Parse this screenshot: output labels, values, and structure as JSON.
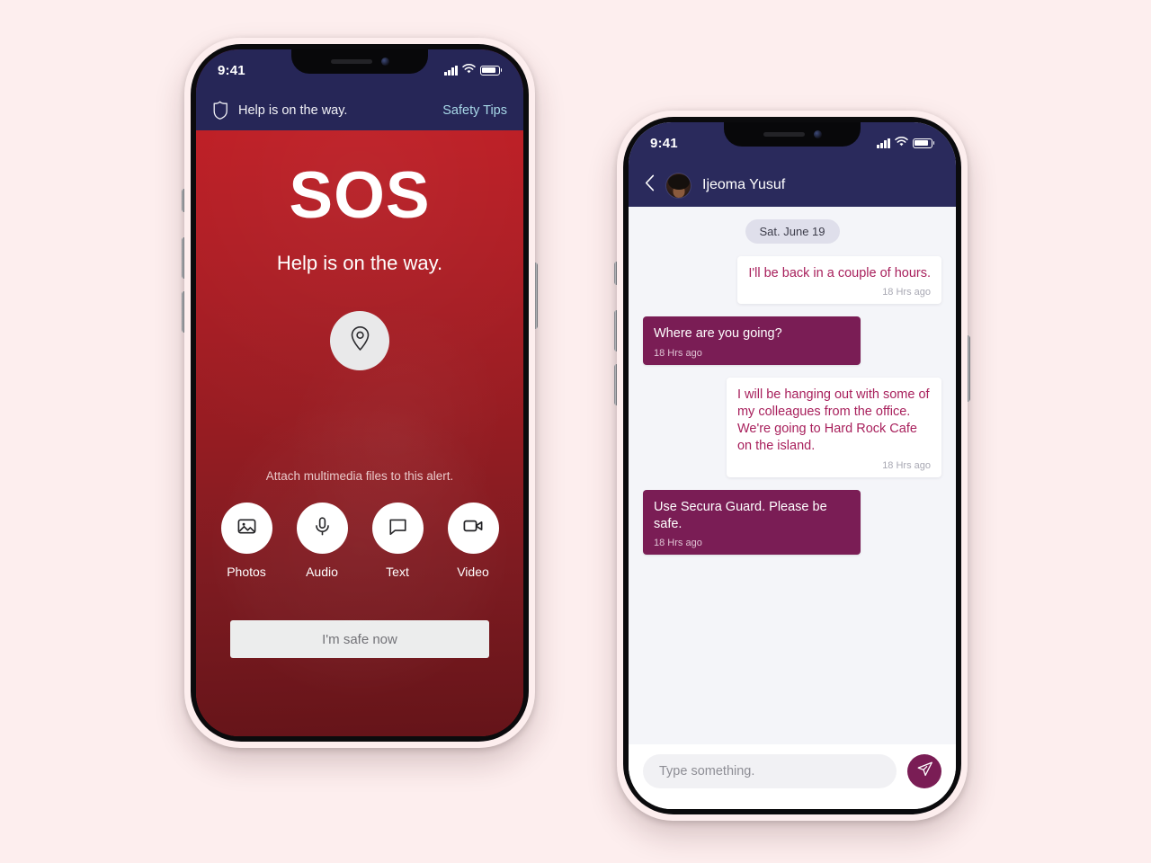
{
  "background_color": "#fdeeee",
  "phones": {
    "sos": {
      "status_bar": {
        "time": "9:41",
        "signal_icon": "signal-bars-icon",
        "wifi_icon": "wifi-icon",
        "battery_icon": "battery-icon"
      },
      "app_bar": {
        "shield_icon": "shield-icon",
        "status_label": "Help is on the way.",
        "safety_tips_link": "Safety Tips",
        "background_color": "#262657",
        "link_color": "#a8d8e8"
      },
      "alert": {
        "title": "SOS",
        "subtitle": "Help is on the way.",
        "location_icon": "location-pin-icon",
        "gradient_from": "#bd1b22",
        "gradient_to": "#651419"
      },
      "attach": {
        "hint": "Attach multimedia files to this alert.",
        "items": [
          {
            "label": "Photos",
            "icon": "photo-icon"
          },
          {
            "label": "Audio",
            "icon": "microphone-icon"
          },
          {
            "label": "Text",
            "icon": "chat-bubble-icon"
          },
          {
            "label": "Video",
            "icon": "video-camera-icon"
          }
        ]
      },
      "safe_button": {
        "label": "I'm safe now",
        "background_color": "#eceded",
        "text_color": "#6f6f74"
      }
    },
    "chat": {
      "status_bar": {
        "time": "9:41",
        "signal_icon": "signal-bars-icon",
        "wifi_icon": "wifi-icon",
        "battery_icon": "battery-icon"
      },
      "app_bar": {
        "back_icon": "back-chevron-icon",
        "avatar_icon": "contact-avatar",
        "contact_name": "Ijeoma Yusuf",
        "background_color": "#2a2a5c"
      },
      "date_divider": "Sat. June 19",
      "messages": [
        {
          "direction": "out",
          "text": "I'll be back in a couple of hours.",
          "time": "18 Hrs ago"
        },
        {
          "direction": "in",
          "text": "Where are you going?",
          "time": "18 Hrs ago"
        },
        {
          "direction": "out",
          "text": "I will be hanging out with some of my colleagues from the office. We're going to Hard Rock Cafe on the island.",
          "time": "18 Hrs ago"
        },
        {
          "direction": "in",
          "text": "Use Secura Guard. Please be safe.",
          "time": "18 Hrs ago"
        }
      ],
      "composer": {
        "placeholder": "Type something.",
        "send_icon": "send-paper-plane-icon",
        "send_color": "#7a1d55"
      },
      "incoming_bubble_color": "#7a1d55",
      "outgoing_text_color": "#a8205c"
    }
  }
}
